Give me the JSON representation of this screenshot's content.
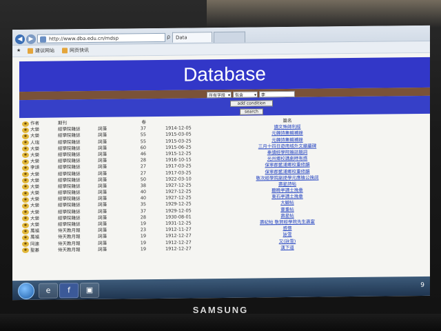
{
  "browser": {
    "address": "http://www.dba.edu.cn/mdsp",
    "tab_label": "Data",
    "favorites": [
      {
        "label": "建议网站"
      },
      {
        "label": "网页快讯"
      }
    ]
  },
  "page": {
    "title": "Database",
    "search": {
      "field_select": "所有字段",
      "mode_select": "包含",
      "query_value": "李",
      "add_condition_label": "add condition",
      "search_label": "search"
    }
  },
  "table": {
    "headers": {
      "name": "作者",
      "magazine": "期刊",
      "vol": "卷",
      "title": "篇名"
    },
    "rows": [
      {
        "name": "大榮",
        "magazine": "經學院雜誌",
        "category": "詞藻",
        "vol": "37",
        "date": "1914-12-05",
        "title": "讀文殊師利經"
      },
      {
        "name": "大榮",
        "magazine": "經學院雜誌",
        "category": "詞藻",
        "vol": "55",
        "date": "1915-03-05",
        "title": "元韓詩集輯補錄"
      },
      {
        "name": "人瑞",
        "magazine": "經學院雜誌",
        "category": "詞藻",
        "vol": "55",
        "date": "1915-03-25",
        "title": "元韓詩集輯補錄"
      },
      {
        "name": "大榮",
        "magazine": "經學院雜誌",
        "category": "詞藻",
        "vol": "60",
        "date": "1915-06-25",
        "title": "三月十四日遊南城外文廟墓碑"
      },
      {
        "name": "大榮",
        "magazine": "經學院雜誌",
        "category": "詞藻",
        "vol": "46",
        "date": "1915-12-25",
        "title": "奉讀經學院雜誌題詞"
      },
      {
        "name": "大榮",
        "magazine": "經學院雜誌",
        "category": "詞藻",
        "vol": "28",
        "date": "1916-10-15",
        "title": "光州鄉校講劇時有感"
      },
      {
        "name": "李頌",
        "magazine": "經學院雜誌",
        "category": "詞藻",
        "vol": "27",
        "date": "1917-03-25",
        "title": "保寧郡藍浦鄉校重修韻"
      },
      {
        "name": "大榮",
        "magazine": "經學院雜誌",
        "category": "詞藻",
        "vol": "27",
        "date": "1917-03-25",
        "title": "保寧郡藍浦鄉校重修韻"
      },
      {
        "name": "大榮",
        "magazine": "經學院雜誌",
        "category": "詞藻",
        "vol": "50",
        "date": "1922-03-10",
        "title": "敬次經學院副提學元應植公挽詞"
      },
      {
        "name": "大榮",
        "magazine": "經學院雜誌",
        "category": "詞藻",
        "vol": "38",
        "date": "1927-12-25",
        "title": "壽星詩帖"
      },
      {
        "name": "大榮",
        "magazine": "經學院雜誌",
        "category": "詞藻",
        "vol": "40",
        "date": "1927-12-25",
        "title": "聽晚亭講士挽章"
      },
      {
        "name": "大榮",
        "magazine": "經學院雜誌",
        "category": "詞藻",
        "vol": "40",
        "date": "1927-12-25",
        "title": "東石亭講士挽章"
      },
      {
        "name": "大榮",
        "magazine": "經學院雜誌",
        "category": "詞藻",
        "vol": "35",
        "date": "1929-12-25",
        "title": "大観帖"
      },
      {
        "name": "大榮",
        "magazine": "經學院雜誌",
        "category": "詞藻",
        "vol": "37",
        "date": "1929-12-05",
        "title": "靈重帖"
      },
      {
        "name": "大榮",
        "magazine": "經學院雜誌",
        "category": "詞藻",
        "vol": "28",
        "date": "1930-08-01",
        "title": "壽星帖"
      },
      {
        "name": "大榮",
        "magazine": "經學院雜誌",
        "category": "詞藻",
        "vol": "19",
        "date": "1931-12-25",
        "title": "壽紀帖 敬賀經學院先生壽宴"
      },
      {
        "name": "萬福",
        "magazine": "侍天教月報",
        "category": "詞藻",
        "vol": "23",
        "date": "1912-11-27",
        "title": "感懷"
      },
      {
        "name": "萬福",
        "magazine": "侍天教月報",
        "category": "詞藻",
        "vol": "19",
        "date": "1912-12-27",
        "title": "詠雪"
      },
      {
        "name": "同進",
        "magazine": "侍天教月報",
        "category": "詞藻",
        "vol": "19",
        "date": "1912-12-27",
        "title": "又(詠雪)"
      },
      {
        "name": "聖基",
        "magazine": "侍天教月報",
        "category": "詞藻",
        "vol": "19",
        "date": "1912-12-27",
        "title": "漢下道"
      }
    ]
  },
  "taskbar": {
    "items": [
      {
        "icon": "ie-icon",
        "label": "e"
      },
      {
        "icon": "facebook-icon",
        "label": "f"
      },
      {
        "icon": "explorer-icon",
        "label": "▣"
      }
    ],
    "tray_text": "9"
  },
  "laptop": {
    "brand": "SAMSUNG"
  }
}
